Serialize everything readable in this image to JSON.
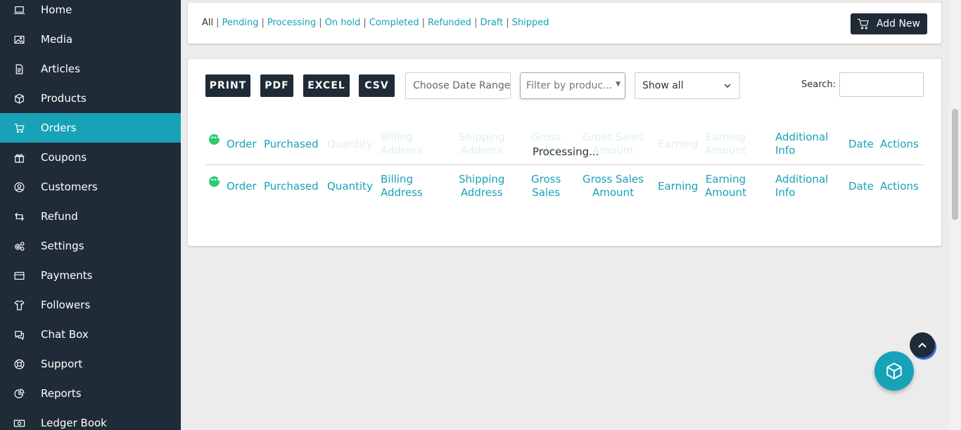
{
  "sidebar": {
    "items": [
      {
        "label": "Home",
        "icon": "laptop-icon"
      },
      {
        "label": "Media",
        "icon": "image-icon"
      },
      {
        "label": "Articles",
        "icon": "document-icon"
      },
      {
        "label": "Products",
        "icon": "cube-icon"
      },
      {
        "label": "Orders",
        "icon": "cart-icon",
        "active": true
      },
      {
        "label": "Coupons",
        "icon": "gift-icon"
      },
      {
        "label": "Customers",
        "icon": "user-circle-icon"
      },
      {
        "label": "Refund",
        "icon": "refund-icon"
      },
      {
        "label": "Settings",
        "icon": "gears-icon"
      },
      {
        "label": "Payments",
        "icon": "credit-card-icon"
      },
      {
        "label": "Followers",
        "icon": "shirt-icon"
      },
      {
        "label": "Chat Box",
        "icon": "chat-icon"
      },
      {
        "label": "Support",
        "icon": "lifebuoy-icon"
      },
      {
        "label": "Reports",
        "icon": "pie-chart-icon"
      },
      {
        "label": "Ledger Book",
        "icon": "money-icon"
      }
    ]
  },
  "status_filter": {
    "all": "All",
    "links": [
      "Pending",
      "Processing",
      "On hold",
      "Completed",
      "Refunded",
      "Draft",
      "Shipped"
    ],
    "separator": "|"
  },
  "toolbar": {
    "add_new_label": "Add New"
  },
  "export_buttons": [
    "PRINT",
    "PDF",
    "EXCEL",
    "CSV"
  ],
  "filters": {
    "date_range_placeholder": "Choose Date Range",
    "product_filter_placeholder": "Filter by produc...",
    "show_all_value": "Show all",
    "search_label": "Search:"
  },
  "table": {
    "columns": [
      "Order",
      "Purchased",
      "Quantity",
      "Billing Address",
      "Shipping Address",
      "Gross Sales",
      "Gross Sales Amount",
      "Earning",
      "Earning Amount",
      "Additional Info",
      "Date",
      "Actions"
    ],
    "columns_split": [
      [
        "Order"
      ],
      [
        "Purchased"
      ],
      [
        "Quantity"
      ],
      [
        "Billing",
        "Address"
      ],
      [
        "Shipping",
        "Address"
      ],
      [
        "Gross",
        "Sales"
      ],
      [
        "Gross Sales",
        "Amount"
      ],
      [
        "Earning"
      ],
      [
        "Earning",
        "Amount"
      ],
      [
        "Additional",
        "Info"
      ],
      [
        "Date"
      ],
      [
        "Actions"
      ]
    ],
    "processing_text": "Processing..."
  },
  "colors": {
    "sidebar_bg": "#1f2b36",
    "accent": "#17a2b8",
    "dark_button": "#1f2b36"
  }
}
